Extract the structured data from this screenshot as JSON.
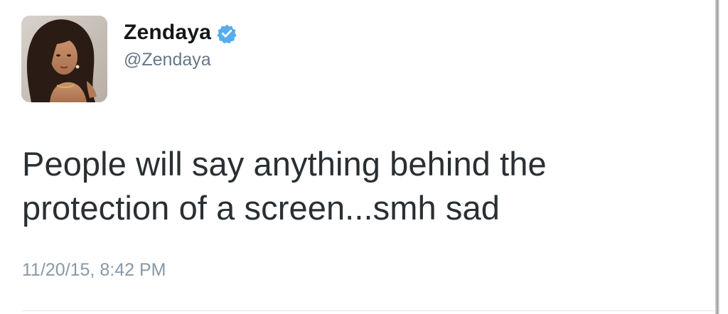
{
  "tweet": {
    "author": {
      "display_name": "Zendaya",
      "handle": "@Zendaya",
      "verified": true,
      "verified_icon": "verified-badge-icon",
      "avatar": "profile-photo"
    },
    "text": "People will say anything behind the protection of a screen...smh sad",
    "timestamp": "11/20/15, 8:42 PM"
  },
  "colors": {
    "name": "#14171a",
    "handle": "#657786",
    "text": "#292f33",
    "timestamp": "#8899a6",
    "verified_badge": "#55acee",
    "divider": "#e1e8ed"
  }
}
